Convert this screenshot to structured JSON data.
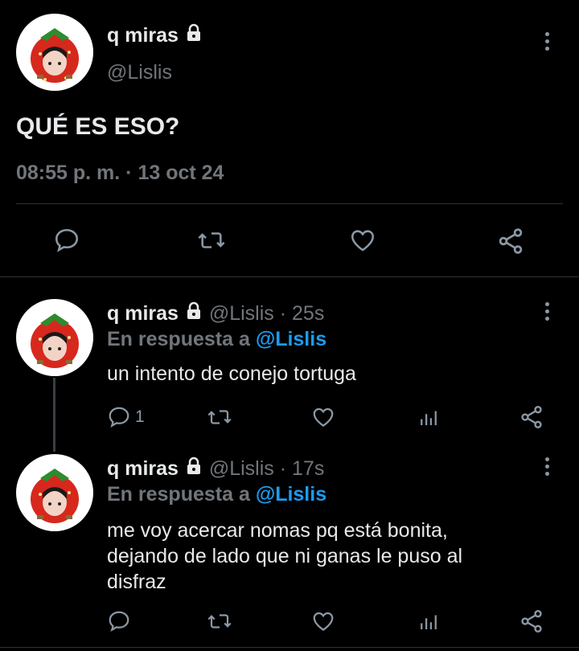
{
  "main_tweet": {
    "display_name": "q miras",
    "handle": "@Lislis",
    "text": "QUÉ ES ESO?",
    "timestamp": "08:55 p. m. · 13 oct 24"
  },
  "replies": [
    {
      "display_name": "q miras",
      "handle": "@Lislis",
      "time": "· 25s",
      "reply_prefix": "En respuesta a",
      "reply_to": "@Lislis",
      "text": "un intento de conejo tortuga",
      "reply_count": "1"
    },
    {
      "display_name": "q miras",
      "handle": "@Lislis",
      "time": "· 17s",
      "reply_prefix": "En respuesta a",
      "reply_to": "@Lislis",
      "text_lines": [
        "me voy acercar nomas pq está bonita,",
        "dejando de lado que ni ganas le puso al",
        "disfraz"
      ],
      "reply_count": ""
    }
  ],
  "colors": {
    "background": "#000000",
    "text": "#e7e9ea",
    "muted": "#71767b",
    "link": "#1d9bf0",
    "icon": "#8b98a5"
  },
  "icons": [
    "lock-icon",
    "more-icon",
    "reply-icon",
    "retweet-icon",
    "like-icon",
    "share-icon",
    "views-icon"
  ]
}
